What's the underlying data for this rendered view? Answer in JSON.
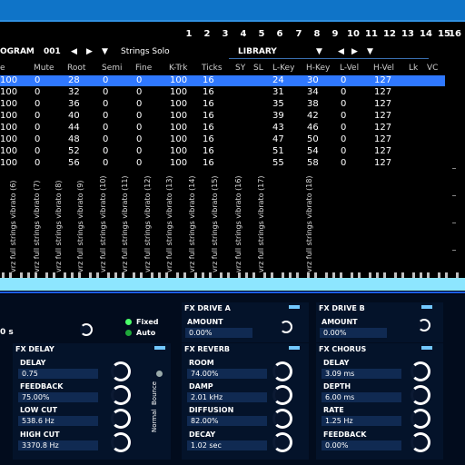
{
  "tabs": [
    "1",
    "2",
    "3",
    "4",
    "5",
    "6",
    "7",
    "8",
    "9",
    "10",
    "11",
    "12",
    "13",
    "14",
    "15",
    "16"
  ],
  "program": {
    "label": "OGRAM",
    "number": "001",
    "name": "Strings Solo",
    "library": "LIBRARY"
  },
  "columns": [
    "e",
    "Mute",
    "Root",
    "Semi",
    "Fine",
    "K-Trk",
    "Ticks",
    "SY",
    "SL",
    "L-Key",
    "H-Key",
    "L-Vel",
    "H-Vel",
    "Lk",
    "VC"
  ],
  "rows": [
    {
      "vol": "100",
      "mute": "0",
      "root": "28",
      "semi": "0",
      "fine": "0",
      "ktrk": "100",
      "ticks": "16",
      "lkey": "24",
      "hkey": "30",
      "lvel": "0",
      "hvel": "127"
    },
    {
      "vol": "100",
      "mute": "0",
      "root": "32",
      "semi": "0",
      "fine": "0",
      "ktrk": "100",
      "ticks": "16",
      "lkey": "31",
      "hkey": "34",
      "lvel": "0",
      "hvel": "127"
    },
    {
      "vol": "100",
      "mute": "0",
      "root": "36",
      "semi": "0",
      "fine": "0",
      "ktrk": "100",
      "ticks": "16",
      "lkey": "35",
      "hkey": "38",
      "lvel": "0",
      "hvel": "127"
    },
    {
      "vol": "100",
      "mute": "0",
      "root": "40",
      "semi": "0",
      "fine": "0",
      "ktrk": "100",
      "ticks": "16",
      "lkey": "39",
      "hkey": "42",
      "lvel": "0",
      "hvel": "127"
    },
    {
      "vol": "100",
      "mute": "0",
      "root": "44",
      "semi": "0",
      "fine": "0",
      "ktrk": "100",
      "ticks": "16",
      "lkey": "43",
      "hkey": "46",
      "lvel": "0",
      "hvel": "127"
    },
    {
      "vol": "100",
      "mute": "0",
      "root": "48",
      "semi": "0",
      "fine": "0",
      "ktrk": "100",
      "ticks": "16",
      "lkey": "47",
      "hkey": "50",
      "lvel": "0",
      "hvel": "127"
    },
    {
      "vol": "100",
      "mute": "0",
      "root": "52",
      "semi": "0",
      "fine": "0",
      "ktrk": "100",
      "ticks": "16",
      "lkey": "51",
      "hkey": "54",
      "lvel": "0",
      "hvel": "127"
    },
    {
      "vol": "100",
      "mute": "0",
      "root": "56",
      "semi": "0",
      "fine": "0",
      "ktrk": "100",
      "ticks": "16",
      "lkey": "55",
      "hkey": "58",
      "lvel": "0",
      "hvel": "127"
    }
  ],
  "samples": [
    "vrz full strings vibrato (6)",
    "vrz full strings vibrato (7)",
    "vrz full strings vibrato (8)",
    "vrz full strings vibrato (9)",
    "vrz full strings vibrato (10)",
    "vrz full strings vibrato (11)",
    "vrz full strings vibrato (12)",
    "vrz full strings vibrato (13)",
    "vrz full strings vibrato (14)",
    "vrz full strings vibrato (15)",
    "vrz full strings vibrato (16)",
    "vrz full strings vibrato (17)",
    "vrz full strings vibrato (18)"
  ],
  "left_misc": {
    "time_value": "0 s",
    "fixed_label": "Fixed",
    "auto_label": "Auto"
  },
  "fx_drive_a": {
    "title": "FX DRIVE A",
    "amount_label": "AMOUNT",
    "amount_value": "0.00%"
  },
  "fx_drive_b": {
    "title": "FX DRIVE B",
    "amount_label": "AMOUNT",
    "amount_value": "0.00%"
  },
  "fx_delay": {
    "title": "FX DELAY",
    "params": [
      {
        "label": "DELAY",
        "value": "0.75"
      },
      {
        "label": "FEEDBACK",
        "value": "75.00%"
      },
      {
        "label": "LOW CUT",
        "value": "538.6 Hz"
      },
      {
        "label": "HIGH CUT",
        "value": "3370.8 Hz"
      }
    ],
    "mode_normal": "Normal",
    "mode_bounce": "Bounce"
  },
  "fx_reverb": {
    "title": "FX REVERB",
    "params": [
      {
        "label": "ROOM",
        "value": "74.00%"
      },
      {
        "label": "DAMP",
        "value": "2.01 kHz"
      },
      {
        "label": "DIFFUSION",
        "value": "82.00%"
      },
      {
        "label": "DECAY",
        "value": "1.02 sec"
      }
    ]
  },
  "fx_chorus": {
    "title": "FX CHORUS",
    "params": [
      {
        "label": "DELAY",
        "value": "3.09 ms"
      },
      {
        "label": "DEPTH",
        "value": "6.00 ms"
      },
      {
        "label": "RATE",
        "value": "1.25 Hz"
      },
      {
        "label": "FEEDBACK",
        "value": "0.00%"
      }
    ]
  },
  "colors": {
    "titlebar": "#0f74c8",
    "selected_row": "#2f78ff",
    "keyboard": "#8de6ff",
    "led": "#73c8ff",
    "panel": "#04132a"
  }
}
